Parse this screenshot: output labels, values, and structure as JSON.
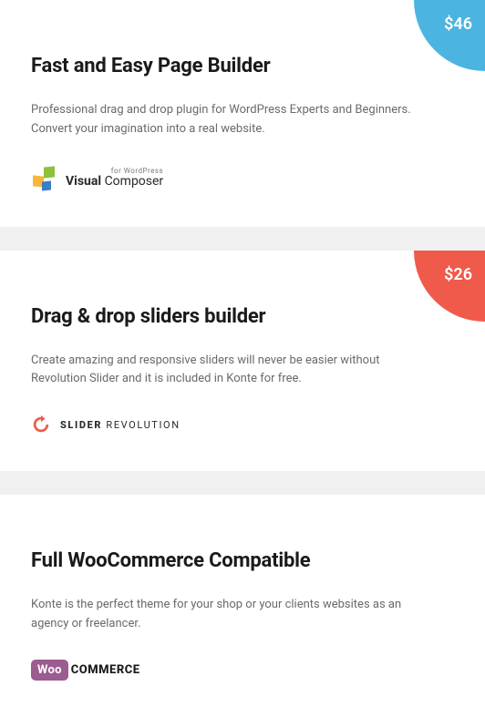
{
  "cards": [
    {
      "badge": "$46",
      "title": "Fast and Easy Page Builder",
      "desc": "Professional drag and drop plugin for WordPress Experts and Beginners. Convert your imagination into a real website.",
      "logo": {
        "small": "for WordPress",
        "bold": "Visual",
        "light": " Composer"
      }
    },
    {
      "badge": "$26",
      "title": "Drag & drop sliders builder",
      "desc": "Create amazing and responsive sliders will never be easier without Revolution Slider and it is included in Konte for free.",
      "logo": {
        "bold": "SLIDER",
        "light": " REVOLUTION"
      }
    },
    {
      "title": "Full WooCommerce Compatible",
      "desc": "Konte is the perfect theme for your shop or your clients websites as an agency or freelancer.",
      "logo": {
        "bubble": "Woo",
        "commerce": "COMMERCE"
      }
    }
  ]
}
